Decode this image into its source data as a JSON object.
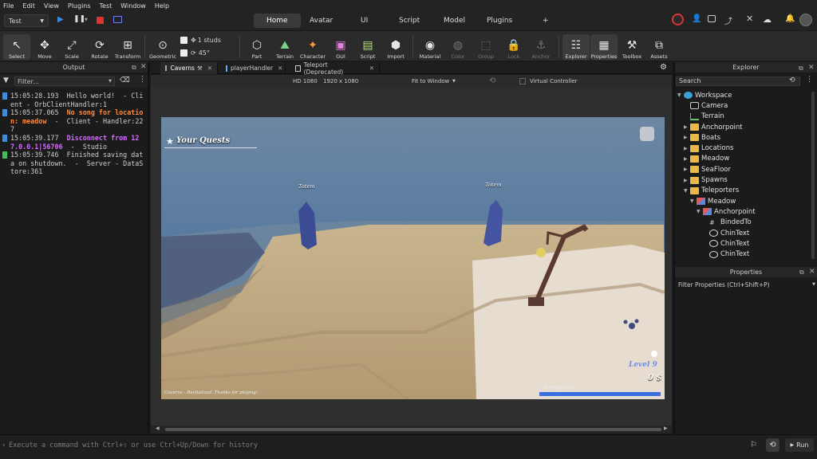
{
  "menu": [
    "File",
    "Edit",
    "View",
    "Plugins",
    "Test",
    "Window",
    "Help"
  ],
  "mode_select": "Test",
  "top_tabs": [
    {
      "label": "Home",
      "active": true
    },
    {
      "label": "Avatar",
      "active": false
    },
    {
      "label": "UI",
      "active": false
    },
    {
      "label": "Script",
      "active": false
    },
    {
      "label": "Model",
      "active": false
    },
    {
      "label": "Plugins",
      "active": false
    },
    {
      "label": "+",
      "active": false
    }
  ],
  "ribbon": {
    "select": "Select",
    "move": "Move",
    "scale": "Scale",
    "rotate": "Rotate",
    "transform": "Transform",
    "geometric": "Geometric",
    "studs": "1 studs",
    "angle": "45°",
    "part": "Part",
    "terrain": "Terrain",
    "character": "Character",
    "gui": "GUI",
    "script": "Script",
    "import": "Import",
    "material": "Material",
    "color": "Color",
    "group": "Group",
    "lock": "Lock",
    "anchor": "Anchor",
    "explorer": "Explorer",
    "properties": "Properties",
    "toolbox": "Toolbox",
    "assets": "Assets"
  },
  "output": {
    "title": "Output",
    "filter_placeholder": "Filter...",
    "lines": [
      {
        "color": "#3b8ede",
        "parts": [
          {
            "t": "15:05:28.193  Hello world!  - Client - OrbClientHandler:1",
            "cls": ""
          }
        ]
      },
      {
        "color": "#3b8ede",
        "parts": [
          {
            "t": "15:05:37.065  ",
            "cls": ""
          },
          {
            "t": "No song for location: meadow",
            "cls": "warn"
          },
          {
            "t": "  -  Client - Handler:227",
            "cls": ""
          }
        ]
      },
      {
        "color": "#3b8ede",
        "parts": [
          {
            "t": "15:05:39.177  ",
            "cls": ""
          },
          {
            "t": "Disconnect from 127.0.0.1|56706",
            "cls": "info"
          },
          {
            "t": "  -  Studio",
            "cls": ""
          }
        ]
      },
      {
        "color": "#3fbf5f",
        "parts": [
          {
            "t": "15:05:39.746  Finished saving data on shutdown.  -  Server - DataStore:361",
            "cls": ""
          }
        ]
      }
    ]
  },
  "doc_tabs": [
    {
      "label": "Caverns",
      "active": true
    },
    {
      "label": "playerHandler",
      "active": false
    },
    {
      "label": "Teleport (Deprecated)",
      "active": false
    }
  ],
  "viewport_toolbar": {
    "device": "HD 1080",
    "resolution": "1920 x 1080",
    "fit": "Fit to Window",
    "virtual_controller": "Virtual Controller"
  },
  "game": {
    "quests_title": "Your Quests",
    "totem_label_1": "Totem",
    "totem_label_2": "Totem",
    "level": "Level 9",
    "money": "0 $",
    "progress_text": "XP Progress 0%",
    "footer": "Caverns - Revitalized. Thanks for playing!"
  },
  "explorer": {
    "title": "Explorer",
    "search_placeholder": "Search",
    "items": [
      {
        "label": "Workspace",
        "depth": 0,
        "arrow": "▼",
        "icon": "globe"
      },
      {
        "label": "Camera",
        "depth": 1,
        "arrow": "",
        "icon": "camera"
      },
      {
        "label": "Terrain",
        "depth": 1,
        "arrow": "",
        "icon": "terrain"
      },
      {
        "label": "Anchorpoint",
        "depth": 1,
        "arrow": "▶",
        "icon": "folder"
      },
      {
        "label": "Boats",
        "depth": 1,
        "arrow": "▶",
        "icon": "folder"
      },
      {
        "label": "Locations",
        "depth": 1,
        "arrow": "▶",
        "icon": "folder"
      },
      {
        "label": "Meadow",
        "depth": 1,
        "arrow": "▶",
        "icon": "folder"
      },
      {
        "label": "SeaFloor",
        "depth": 1,
        "arrow": "▶",
        "icon": "folder"
      },
      {
        "label": "Spawns",
        "depth": 1,
        "arrow": "▶",
        "icon": "folder"
      },
      {
        "label": "Teleporters",
        "depth": 1,
        "arrow": "▼",
        "icon": "folder"
      },
      {
        "label": "Meadow",
        "depth": 2,
        "arrow": "▼",
        "icon": "model"
      },
      {
        "label": "Anchorpoint",
        "depth": 3,
        "arrow": "▼",
        "icon": "model"
      },
      {
        "label": "BindedTo",
        "depth": 4,
        "arrow": "",
        "icon": "hash"
      },
      {
        "label": "ChinText",
        "depth": 4,
        "arrow": "",
        "icon": "globe2"
      },
      {
        "label": "ChinText",
        "depth": 4,
        "arrow": "",
        "icon": "globe2"
      },
      {
        "label": "ChinText",
        "depth": 4,
        "arrow": "",
        "icon": "globe2"
      }
    ]
  },
  "properties": {
    "title": "Properties",
    "filter_placeholder": "Filter Properties (Ctrl+Shift+P)"
  },
  "command_bar": {
    "placeholder": "Execute a command with Ctrl+⇧ or use Ctrl+Up/Down for history",
    "run": "Run"
  },
  "colors": {
    "accent_blue": "#3b8ede",
    "warn": "#ff8b3d",
    "info": "#d66bff"
  }
}
